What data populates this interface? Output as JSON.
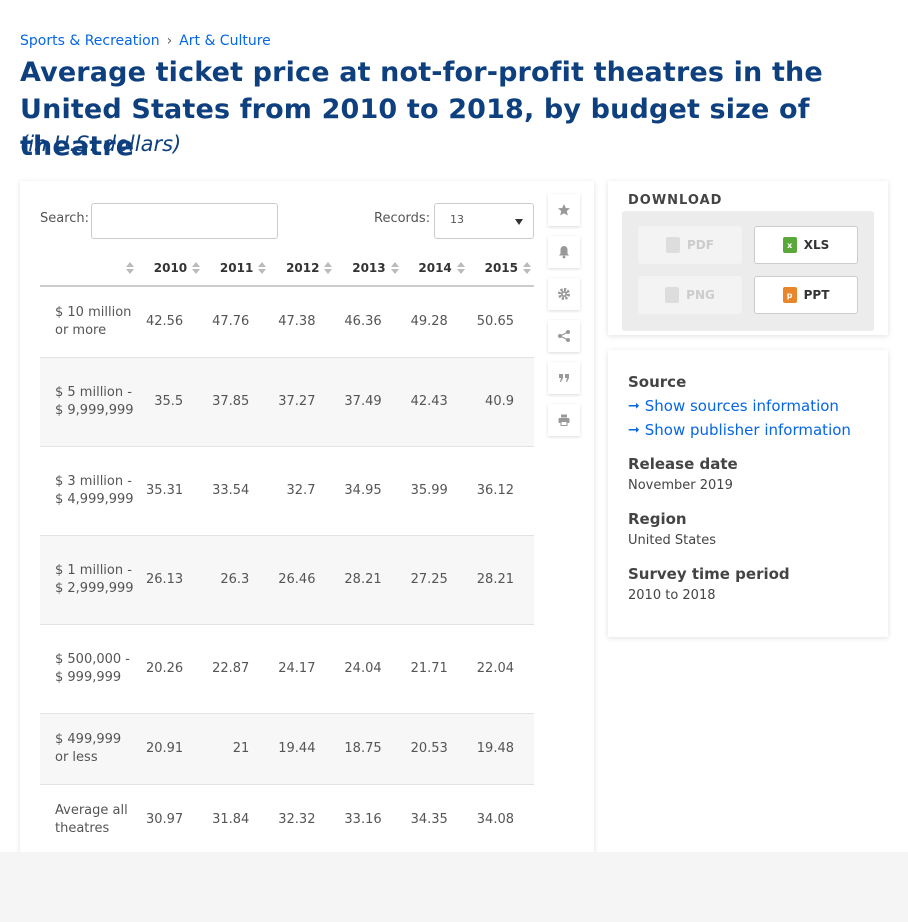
{
  "breadcrumb": {
    "items": [
      "Sports & Recreation",
      "Art & Culture"
    ]
  },
  "title": "Average ticket price at not-for-profit theatres in the United States from 2010 to 2018, by budget size of theatre",
  "subtitle": "(in U.S. dollars)",
  "table_controls": {
    "search_label": "Search:",
    "search_value": "",
    "records_label": "Records:",
    "records_value": "13"
  },
  "table": {
    "columns": [
      "",
      "2010",
      "2011",
      "2012",
      "2013",
      "2014",
      "2015"
    ],
    "rows": [
      {
        "label": "$ 10 million or more",
        "values": [
          "42.56",
          "47.76",
          "47.38",
          "46.36",
          "49.28",
          "50.65"
        ]
      },
      {
        "label": "$ 5 million - $ 9,999,999",
        "values": [
          "35.5",
          "37.85",
          "37.27",
          "37.49",
          "42.43",
          "40.9"
        ]
      },
      {
        "label": "$ 3 million - $ 4,999,999",
        "values": [
          "35.31",
          "33.54",
          "32.7",
          "34.95",
          "35.99",
          "36.12"
        ]
      },
      {
        "label": "$ 1 million - $ 2,999,999",
        "values": [
          "26.13",
          "26.3",
          "26.46",
          "28.21",
          "27.25",
          "28.21"
        ]
      },
      {
        "label": "$ 500,000 - $ 999,999",
        "values": [
          "20.26",
          "22.87",
          "24.17",
          "24.04",
          "21.71",
          "22.04"
        ]
      },
      {
        "label": "$ 499,999 or less",
        "values": [
          "20.91",
          "21",
          "19.44",
          "18.75",
          "20.53",
          "19.48"
        ]
      },
      {
        "label": "Average all theatres",
        "values": [
          "30.97",
          "31.84",
          "32.32",
          "33.16",
          "34.35",
          "34.08"
        ]
      }
    ]
  },
  "side_icons": [
    "star-icon",
    "bell-icon",
    "gear-icon",
    "share-icon",
    "quote-icon",
    "print-icon"
  ],
  "download": {
    "title": "DOWNLOAD",
    "buttons": [
      {
        "label": "PDF",
        "enabled": false
      },
      {
        "label": "XLS",
        "enabled": true
      },
      {
        "label": "PNG",
        "enabled": false
      },
      {
        "label": "PPT",
        "enabled": true
      }
    ]
  },
  "info": {
    "source_heading": "Source",
    "show_sources": "Show sources information",
    "show_publisher": "Show publisher information",
    "release_heading": "Release date",
    "release_value": "November 2019",
    "region_heading": "Region",
    "region_value": "United States",
    "period_heading": "Survey time period",
    "period_value": "2010 to 2018"
  },
  "colors": {
    "title": "#0e3f7e",
    "link": "#0666e5",
    "xls_icon": "#5aa83a",
    "ppt_icon": "#e8862a"
  }
}
